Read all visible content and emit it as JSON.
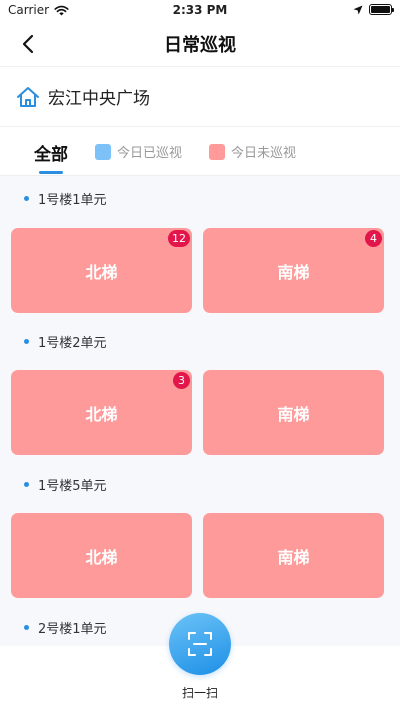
{
  "status_bar": {
    "carrier": "Carrier",
    "time": "2:33 PM"
  },
  "nav": {
    "title": "日常巡视"
  },
  "site": {
    "name": "宏江中央广场"
  },
  "tabs": {
    "all_label": "全部",
    "legend_done": "今日已巡视",
    "legend_pending": "今日未巡视"
  },
  "colors": {
    "accent": "#2a8fe0",
    "done": "#7cc1f7",
    "pending": "#ff9a9a",
    "badge": "#e2164a"
  },
  "groups": [
    {
      "title": "1号楼1单元",
      "left": {
        "label": "北梯",
        "badge": "12"
      },
      "right": {
        "label": "南梯",
        "badge": "4"
      }
    },
    {
      "title": "1号楼2单元",
      "left": {
        "label": "北梯",
        "badge": "3"
      },
      "right": {
        "label": "南梯"
      }
    },
    {
      "title": "1号楼5单元",
      "left": {
        "label": "北梯"
      },
      "right": {
        "label": "南梯"
      }
    },
    {
      "title": "2号楼1单元"
    }
  ],
  "scan": {
    "label": "扫一扫"
  }
}
